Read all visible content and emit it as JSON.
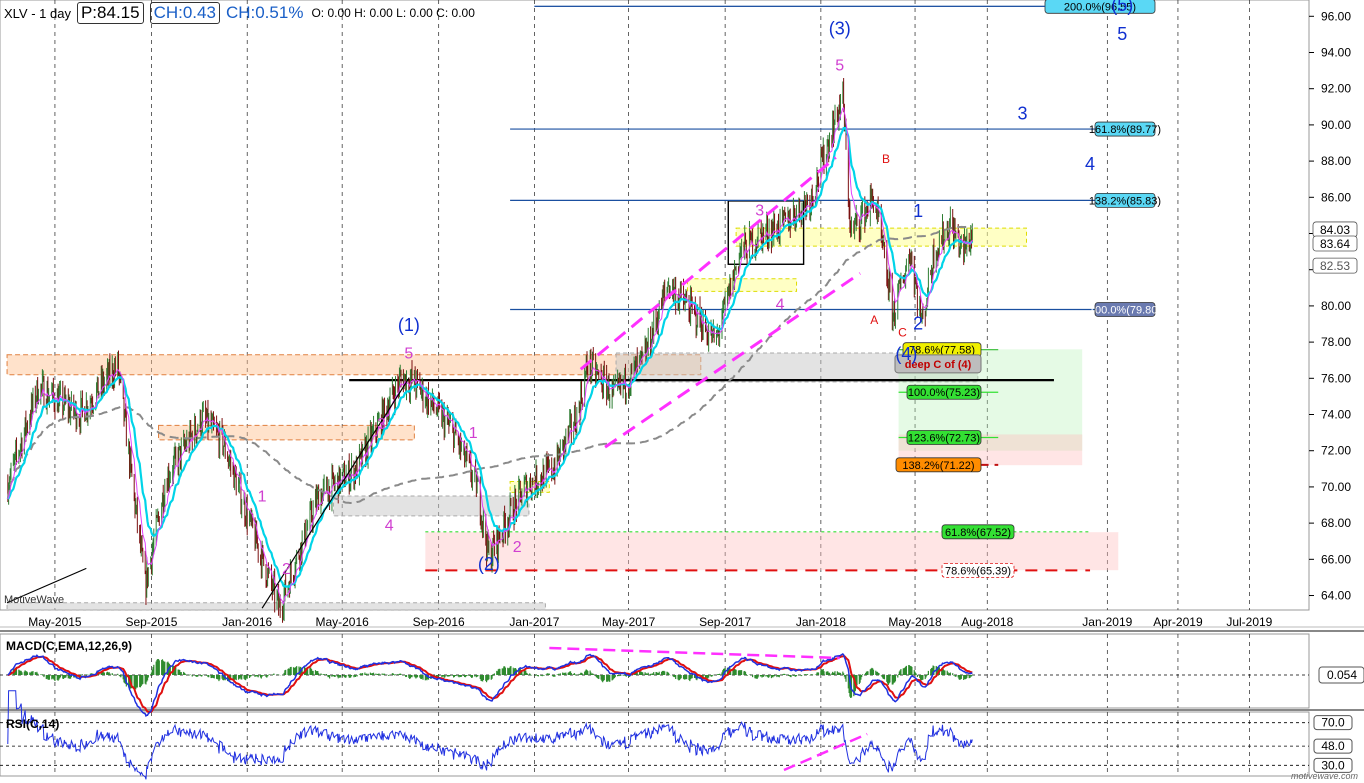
{
  "header": {
    "symbol": "XLV - 1 day",
    "price": "P:84.15",
    "change": "CH:0.43",
    "change_pct": "CH:0.51%",
    "ohlc": "O: 0.00  H: 0.00  L: 0.00  C: 0.00"
  },
  "watermark": "MotiveWave",
  "footer_credit": "motivewave.com",
  "colors": {
    "price_up": "#2e7d32",
    "price_down": "#7b1010",
    "ema_fast": "#e040fb",
    "ema_mid": "#00d4e8",
    "sma_slow": "#8a8a8a",
    "wave_blue": "#1030d0",
    "wave_magenta": "#d040d0",
    "wave_red": "#e01010",
    "fib_line": "#1a4fa0",
    "macd": "#2030e0",
    "signal": "#e01010",
    "hist": "#2e8b2e"
  },
  "chart_data": [
    {
      "type": "line",
      "title": "",
      "xlabel": "",
      "ylabel": "",
      "ylim": [
        63.2,
        96.9
      ],
      "y_ticks": [
        "64.00",
        "66.00",
        "68.00",
        "70.00",
        "72.00",
        "74.00",
        "76.00",
        "78.00",
        "80.00",
        "82.00",
        "84.00",
        "86.00",
        "88.00",
        "90.00",
        "92.00",
        "94.00",
        "96.00"
      ],
      "x_ticks": [
        "May-2015",
        "Sep-2015",
        "Jan-2016",
        "May-2016",
        "Sep-2016",
        "Jan-2017",
        "May-2017",
        "Sep-2017",
        "Jan-2018",
        "May-2018",
        "Aug-2018",
        "Jan-2019",
        "Apr-2019",
        "Jul-2019"
      ],
      "x_tick_dates": [
        "2015-05",
        "2015-09",
        "2016-01",
        "2016-05",
        "2016-09",
        "2017-01",
        "2017-05",
        "2017-09",
        "2018-01",
        "2018-05",
        "2018-08",
        "2019-01",
        "2019-04",
        "2019-07"
      ],
      "series": [
        {
          "name": "",
          "x": [
            "2015-03-01",
            "2015-04-10",
            "2015-06-01",
            "2015-07-20",
            "2015-08-24",
            "2015-09-20",
            "2015-11-05",
            "2015-12-01",
            "2016-01-20",
            "2016-02-11",
            "2016-04-01",
            "2016-05-20",
            "2016-07-15",
            "2016-08-01",
            "2016-09-20",
            "2016-10-20",
            "2016-11-04",
            "2016-11-25",
            "2016-12-20",
            "2017-01-25",
            "2017-02-25",
            "2017-03-10",
            "2017-04-13",
            "2017-05-20",
            "2017-06-20",
            "2017-07-25",
            "2017-08-20",
            "2017-09-20",
            "2017-10-20",
            "2017-11-15",
            "2017-12-20",
            "2018-01-29",
            "2018-02-08",
            "2018-03-10",
            "2018-04-03",
            "2018-04-25",
            "2018-05-10",
            "2018-05-25",
            "2018-06-15",
            "2018-07-01",
            "2018-07-15"
          ],
          "values": [
            70.0,
            75.5,
            74.0,
            76.7,
            64.5,
            70.5,
            73.8,
            72.5,
            66.0,
            63.3,
            69.5,
            71.0,
            76.0,
            75.8,
            73.0,
            70.0,
            66.1,
            68.0,
            70.0,
            71.0,
            74.0,
            76.8,
            75.0,
            77.0,
            81.2,
            79.5,
            78.0,
            83.0,
            84.0,
            84.5,
            86.0,
            91.6,
            84.0,
            86.0,
            79.5,
            83.0,
            79.0,
            83.0,
            84.5,
            83.0,
            84.15
          ]
        }
      ],
      "fib_levels": [
        {
          "label": "200.0%(96.55)",
          "value": 96.55,
          "color": "#5ad8f5"
        },
        {
          "label": "161.8%(89.77)",
          "value": 89.77,
          "color": "#5ad8f5"
        },
        {
          "label": "138.2%(85.83)",
          "value": 85.83,
          "color": "#5ad8f5"
        },
        {
          "label": "100.0%(79.80)",
          "value": 79.8,
          "color": "#6a7ab0"
        },
        {
          "label": "78.6%(77.58)",
          "value": 77.58,
          "color": "#f0f000"
        },
        {
          "label": "100.0%(75.23)",
          "value": 75.23,
          "color": "#33e033"
        },
        {
          "label": "123.6%(72.73)",
          "value": 72.73,
          "color": "#33e033"
        },
        {
          "label": "138.2%(71.22)",
          "value": 71.22,
          "color": "#ff8c00"
        },
        {
          "label": "61.8%(67.52)",
          "value": 67.52,
          "color": "#33e033"
        },
        {
          "label": "78.6%(65.39)",
          "value": 65.39,
          "color": "#ffffff"
        }
      ],
      "deep_c_label": "deep C of (4)",
      "price_labels": [
        "84.03",
        "83.64",
        "82.53"
      ],
      "wave_labels": [
        {
          "t": "(1)",
          "c": "blue",
          "x": "2016-07-25",
          "y": 78.6
        },
        {
          "t": "5",
          "c": "magenta",
          "x": "2016-07-25",
          "y": 77.1
        },
        {
          "t": "(2)",
          "c": "blue",
          "x": "2016-11-04",
          "y": 65.4
        },
        {
          "t": "2",
          "c": "magenta",
          "x": "2016-12-10",
          "y": 66.4
        },
        {
          "t": "(3)",
          "c": "blue",
          "x": "2018-01-25",
          "y": 95.0
        },
        {
          "t": "5",
          "c": "magenta",
          "x": "2018-01-25",
          "y": 93.0
        },
        {
          "t": "(4)",
          "c": "blue",
          "x": "2018-04-20",
          "y": 77.0
        },
        {
          "t": "(5)",
          "c": "blue",
          "x": "2019-01-20",
          "y": 96.3
        },
        {
          "t": "5",
          "c": "blue",
          "x": "2019-01-20",
          "y": 94.7
        },
        {
          "t": "3",
          "c": "blue",
          "x": "2018-09-15",
          "y": 90.3
        },
        {
          "t": "4",
          "c": "blue",
          "x": "2018-12-10",
          "y": 87.5
        },
        {
          "t": "1",
          "c": "blue",
          "x": "2018-05-05",
          "y": 84.9
        },
        {
          "t": "2",
          "c": "blue",
          "x": "2018-05-05",
          "y": 78.7
        },
        {
          "t": "A",
          "c": "red",
          "x": "2018-03-10",
          "y": 79.0
        },
        {
          "t": "B",
          "c": "red",
          "x": "2018-03-25",
          "y": 87.9
        },
        {
          "t": "C",
          "c": "red",
          "x": "2018-04-15",
          "y": 78.3
        },
        {
          "t": "1",
          "c": "magenta",
          "x": "2016-01-20",
          "y": 69.2
        },
        {
          "t": "2",
          "c": "magenta",
          "x": "2016-02-20",
          "y": 65.2
        },
        {
          "t": "3",
          "c": "magenta",
          "x": "2016-06-20",
          "y": 73.2
        },
        {
          "t": "4",
          "c": "magenta",
          "x": "2016-06-30",
          "y": 67.6
        },
        {
          "t": "1",
          "c": "magenta",
          "x": "2016-10-15",
          "y": 72.7
        },
        {
          "t": "3",
          "c": "magenta",
          "x": "2017-10-15",
          "y": 85.0
        },
        {
          "t": "4",
          "c": "magenta",
          "x": "2017-11-10",
          "y": 79.8
        }
      ]
    },
    {
      "type": "line",
      "title": "MACD(C,EMA,12,26,9)",
      "value_label": "0.054",
      "ylim": [
        -2.2,
        2.2
      ]
    },
    {
      "type": "line",
      "title": "RSI(C,14)",
      "levels": [
        "70.0",
        "48.0",
        "30.0"
      ],
      "ylim": [
        20,
        80
      ]
    }
  ]
}
